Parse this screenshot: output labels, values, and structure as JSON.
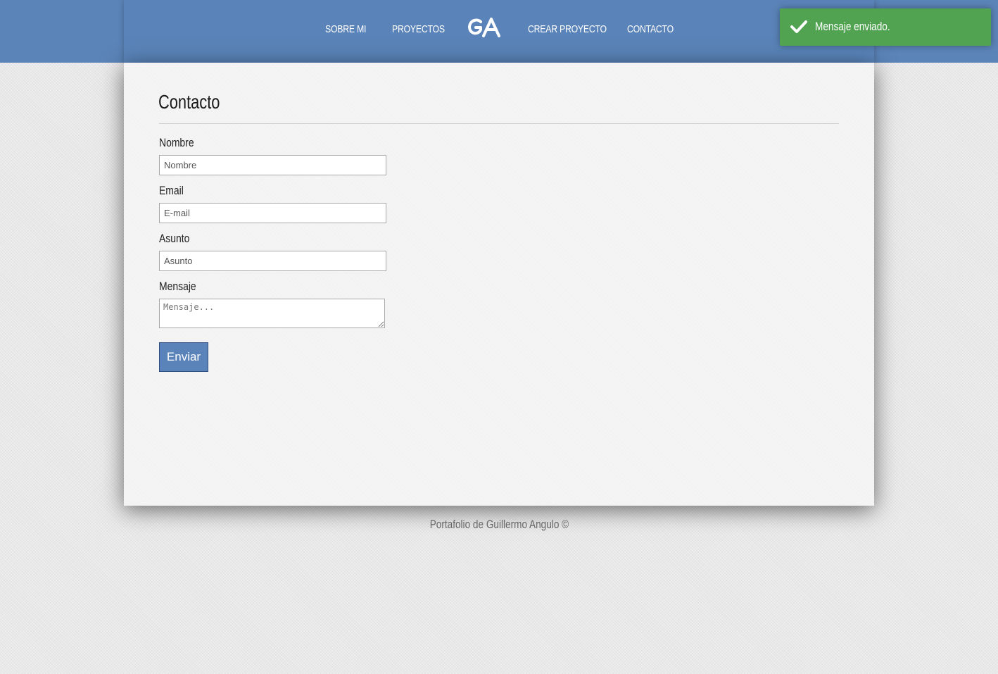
{
  "nav": {
    "items": [
      {
        "label": "SOBRE MI"
      },
      {
        "label": "PROYECTOS"
      },
      {
        "label": "CREAR PROYECTO"
      },
      {
        "label": "CONTACTO"
      }
    ],
    "logo_text": "GA",
    "color": "#5a84b9"
  },
  "page": {
    "title": "Contacto"
  },
  "form": {
    "name": {
      "label": "Nombre",
      "placeholder": "Nombre"
    },
    "email": {
      "label": "Email",
      "placeholder": "E-mail"
    },
    "subject": {
      "label": "Asunto",
      "placeholder": "Asunto"
    },
    "message": {
      "label": "Mensaje",
      "placeholder": "Mensaje..."
    },
    "submit_label": "Enviar"
  },
  "footer": {
    "text": "Portafolio de Guillermo Angulo ©"
  },
  "toast": {
    "message": "Mensaje enviado.",
    "icon": "checkmark-icon",
    "color": "#51a351"
  }
}
